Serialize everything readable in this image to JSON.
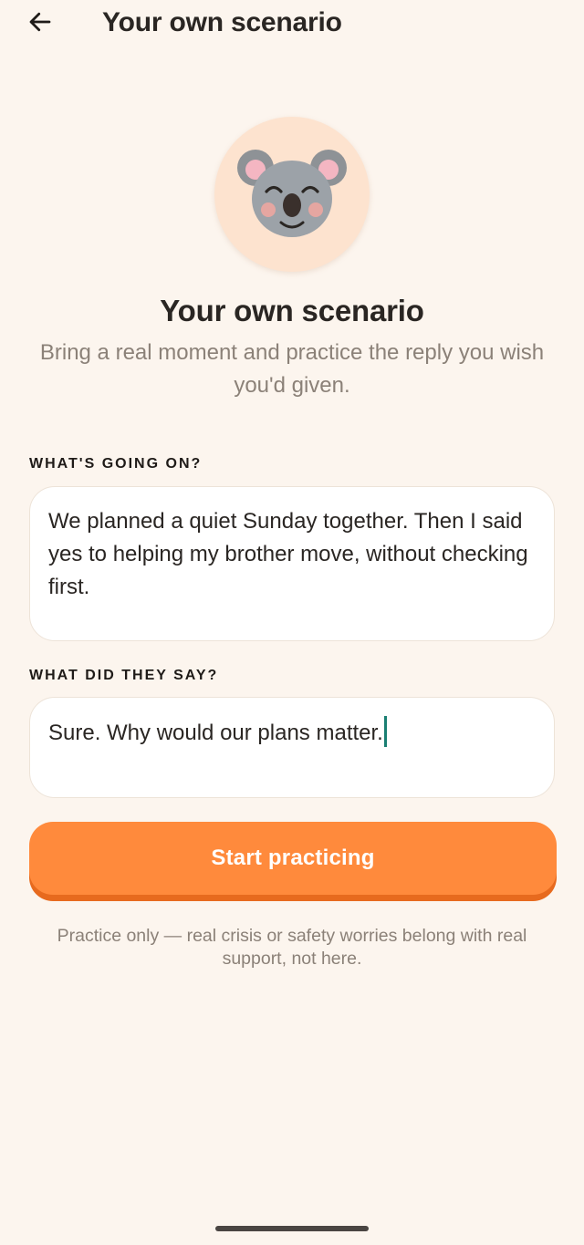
{
  "app_bar": {
    "title": "Your own scenario",
    "back_icon": "arrow-left-icon"
  },
  "avatar": {
    "icon": "koala-face-icon",
    "background": "#FDE3CF"
  },
  "hero": {
    "title": "Your own scenario",
    "subtitle": "Bring a real moment and practice the reply you wish you'd given."
  },
  "fields": {
    "situation": {
      "label": "WHAT'S GOING ON?",
      "value": "We planned a quiet Sunday together. Then I said yes to helping my brother move, without checking first."
    },
    "their_words": {
      "label": "WHAT DID THEY SAY?",
      "value": "Sure. Why would our plans matter."
    }
  },
  "cta": {
    "label": "Start practicing",
    "color": "#FF8A3C"
  },
  "disclaimer": "Practice only — real crisis or safety worries belong with real support, not here.",
  "colors": {
    "background": "#FCF5EE",
    "accent": "#FF8A3C",
    "caret": "#1A7F73",
    "muted_text": "#8B8178"
  }
}
